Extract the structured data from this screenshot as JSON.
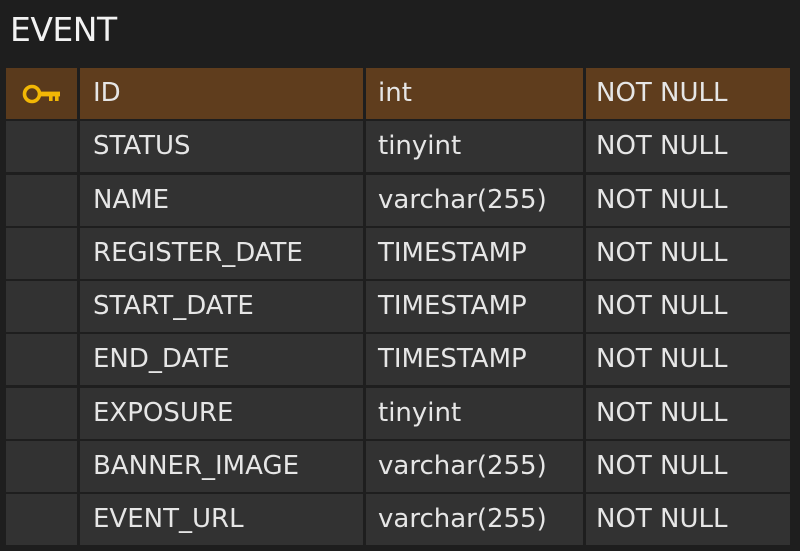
{
  "entity": {
    "name": "EVENT",
    "key_icon": "key-icon",
    "key_color": "#f2b705",
    "pk_row_color": "#5f3d1d",
    "columns": [
      {
        "name": "ID",
        "type": "int",
        "nullability": "NOT NULL",
        "primary_key": true
      },
      {
        "name": "STATUS",
        "type": "tinyint",
        "nullability": "NOT NULL",
        "primary_key": false
      },
      {
        "name": "NAME",
        "type": "varchar(255)",
        "nullability": "NOT NULL",
        "primary_key": false
      },
      {
        "name": "REGISTER_DATE",
        "type": "TIMESTAMP",
        "nullability": "NOT NULL",
        "primary_key": false
      },
      {
        "name": "START_DATE",
        "type": "TIMESTAMP",
        "nullability": "NOT NULL",
        "primary_key": false
      },
      {
        "name": "END_DATE",
        "type": "TIMESTAMP",
        "nullability": "NOT NULL",
        "primary_key": false
      },
      {
        "name": "EXPOSURE",
        "type": "tinyint",
        "nullability": "NOT NULL",
        "primary_key": false
      },
      {
        "name": "BANNER_IMAGE",
        "type": "varchar(255)",
        "nullability": "NOT NULL",
        "primary_key": false
      },
      {
        "name": "EVENT_URL",
        "type": "varchar(255)",
        "nullability": "NOT NULL",
        "primary_key": false
      }
    ]
  }
}
